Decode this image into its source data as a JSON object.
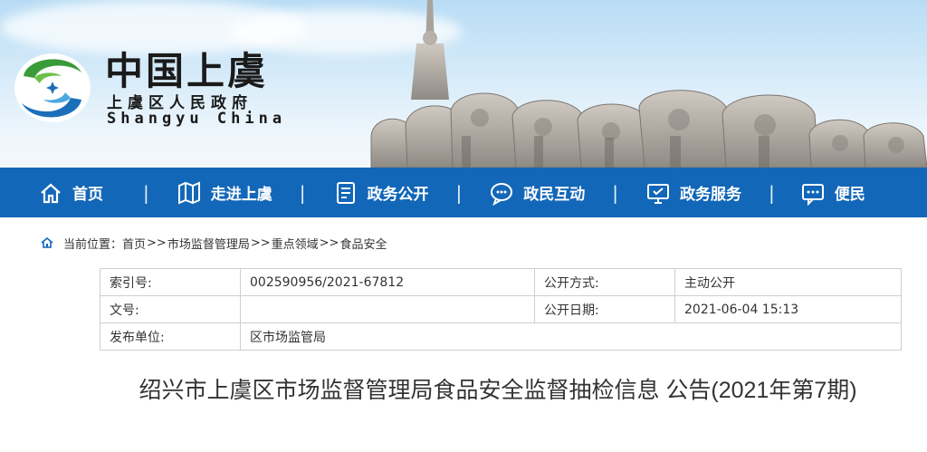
{
  "header": {
    "logo_title": "中国上虞",
    "logo_subtitle": "上虞区人民政府",
    "logo_english": "Shangyu China",
    "logo_icon": "shangyu-emblem-icon",
    "banner_image": "stone-elephant-statues"
  },
  "nav": {
    "items": [
      {
        "label": "首页",
        "icon": "home-icon"
      },
      {
        "label": "走进上虞",
        "icon": "map-icon"
      },
      {
        "label": "政务公开",
        "icon": "document-icon"
      },
      {
        "label": "政民互动",
        "icon": "chat-icon"
      },
      {
        "label": "政务服务",
        "icon": "monitor-icon"
      },
      {
        "label": "便民",
        "icon": "message-icon"
      }
    ],
    "separator": "|",
    "background": "#1367b8"
  },
  "breadcrumb": {
    "prefix": "当前位置：",
    "items": [
      "首页",
      "市场监督管理局",
      "重点领域",
      "食品安全"
    ],
    "separator": ">>"
  },
  "info": {
    "index_label": "索引号:",
    "index_value": "002590956/2021-67812",
    "method_label": "公开方式:",
    "method_value": "主动公开",
    "doc_label": "文号:",
    "doc_value": "",
    "date_label": "公开日期:",
    "date_value": "2021-06-04 15:13",
    "publisher_label": "发布单位:",
    "publisher_value": "区市场监管局"
  },
  "article": {
    "title": "绍兴市上虞区市场监督管理局食品安全监督抽检信息 公告(2021年第7期)"
  }
}
